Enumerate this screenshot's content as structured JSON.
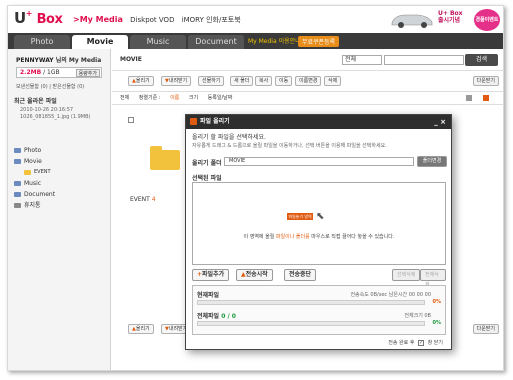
{
  "header": {
    "logo_u": "U",
    "logo_plus": "+",
    "logo_box": "Box",
    "nav": [
      ">My Media",
      "Diskpot VOD",
      "iMORY 인화/포토북"
    ],
    "ad_line1": "U+ Box",
    "ad_line2": "출시기념",
    "ad_badge": "경품이벤트"
  },
  "tabs": [
    "Photo",
    "Movie",
    "Music",
    "Document"
  ],
  "active_tab": "Movie",
  "tab_extra": "My Media 이용안내",
  "tab_extra_btn": "무료쿠폰등록",
  "sidebar": {
    "user_name": "PENNYWAY",
    "user_suffix": "님의 My Media",
    "quota_used": "2.2MB",
    "quota_total": " / 1GB",
    "quota_btn": "용량추가",
    "quota_links": "보낸선물함 (0) | 받은선물함 (0)",
    "recent_title": "최근 올라온 파일",
    "recent_date": "2010-10-26 20:16:57",
    "recent_file": "1026_081855_1.jpg (1.9MB)",
    "tree": [
      {
        "label": "Photo",
        "sub": false
      },
      {
        "label": "Movie",
        "sub": false
      },
      {
        "label": "EVENT",
        "sub": true
      },
      {
        "label": "Music",
        "sub": false
      },
      {
        "label": "Document",
        "sub": false
      },
      {
        "label": "휴지통",
        "sub": false
      }
    ]
  },
  "main": {
    "folder_title": "MOVIE",
    "search_select": "전체",
    "search_btn": "검색",
    "toolbar": [
      "올리기",
      "내려받기",
      "선물하기",
      "새 폴더",
      "복사",
      "이동",
      "이름변경",
      "삭제"
    ],
    "toolbar_right": "다운받기",
    "sort_all": "전체",
    "sort_label": "정렬기준 :",
    "sort_name": "이름",
    "sort_size": "크기",
    "sort_date": "등록일/날짜",
    "file_name": "EVENT",
    "file_count": "4"
  },
  "dialog": {
    "title": "파일 올리기",
    "minimize": "_",
    "close": "×",
    "desc": "올리기 할 파일을 선택하세요.",
    "desc_small": "자유롭게 드래그 & 드롭으로 올릴 파일을 이동하거나, 선택 버튼을 이용해 파일을 선택하세요.",
    "folder_label": "올리기 폴더",
    "folder_value": "MOVIE",
    "folder_btn": "폴더변경",
    "selected_label": "선택된 파일",
    "drop_hint": "파일놓기 영역",
    "drop_text_pre": "이 영역에 올릴 ",
    "drop_text_hl": "파일이나 폴더를",
    "drop_text_post": " 마우스로 직접 끌어다 놓을 수 있습니다.",
    "add_btn": "파일추가",
    "start_btn": "전송시작",
    "stop_btn": "전송중단",
    "remove_sel": "선택삭제",
    "remove_all": "전체삭제",
    "current_label": "현재파일",
    "current_meta": "전송속도  0B/sec  남은시간  00 00 00",
    "current_pct": "0%",
    "total_label": "전체파일",
    "total_count": "0 / 0",
    "total_meta": "전체크기  0B",
    "total_pct": "0%",
    "footer_text": "전송 완료 후",
    "footer_check": "✓",
    "footer_close": "창 닫기"
  }
}
